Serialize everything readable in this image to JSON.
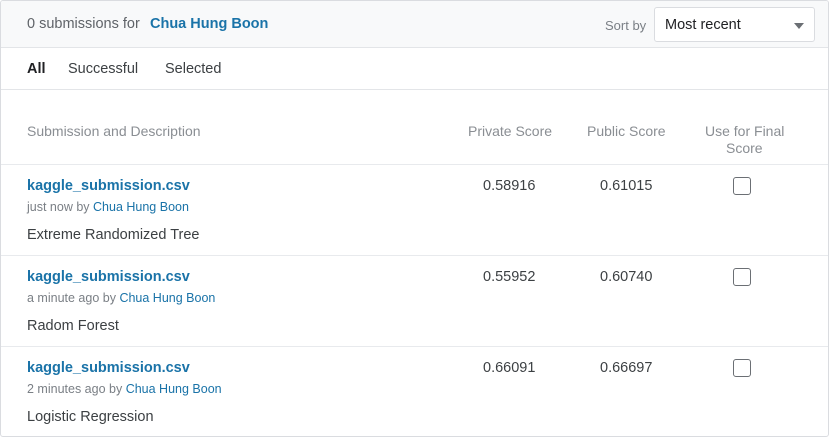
{
  "header": {
    "count_text": "0 submissions for",
    "owner": "Chua Hung Boon",
    "sort_label": "Sort by",
    "sort_value": "Most recent"
  },
  "tabs": [
    {
      "label": "All",
      "active": true
    },
    {
      "label": "Successful",
      "active": false
    },
    {
      "label": "Selected",
      "active": false
    }
  ],
  "columns": {
    "submission": "Submission and Description",
    "private": "Private Score",
    "public": "Public Score",
    "final_line1": "Use for Final",
    "final_line2": "Score"
  },
  "rows": [
    {
      "file": "kaggle_submission.csv",
      "time": "just now by",
      "user": "Chua Hung Boon",
      "description": "Extreme Randomized Tree",
      "private_score": "0.58916",
      "public_score": "0.61015",
      "use_for_final": false
    },
    {
      "file": "kaggle_submission.csv",
      "time": "a minute ago by",
      "user": "Chua Hung Boon",
      "description": "Radom Forest",
      "private_score": "0.55952",
      "public_score": "0.60740",
      "use_for_final": false
    },
    {
      "file": "kaggle_submission.csv",
      "time": "2 minutes ago by",
      "user": "Chua Hung Boon",
      "description": "Logistic Regression",
      "private_score": "0.66091",
      "public_score": "0.66697",
      "use_for_final": false
    }
  ]
}
